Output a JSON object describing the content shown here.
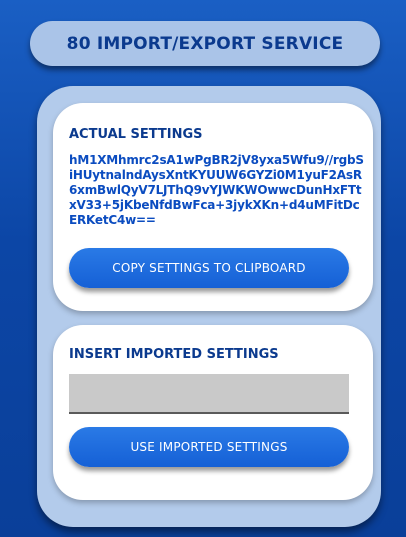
{
  "header": {
    "title": "80 IMPORT/EXPORT SERVICE"
  },
  "actual_settings": {
    "heading": "ACTUAL SETTINGS",
    "value": "hM1XMhmrc2sA1wPgBR2jV8yxa5Wfu9//rgbSiHUytnalndAysXntKYUUW6GYZi0M1yuF2AsR6xmBwlQyV7LJThQ9vYJWKWOwwcDunHxFTtxV33+5jKbeNfdBwFca+3jykXKn+d4uMFitDcERKetC4w==",
    "copy_button_label": "COPY SETTINGS TO CLIPBOARD"
  },
  "insert_settings": {
    "heading": "INSERT IMPORTED SETTINGS",
    "input_value": "",
    "input_placeholder": "",
    "use_button_label": "USE IMPORTED SETTINGS"
  },
  "colors": {
    "background": "#0f4fb0",
    "panel": "#b3cbeb",
    "heading_text": "#0b3a8e",
    "settings_text": "#0b4cc0",
    "button": "#1f6de0",
    "input_fill": "#c9c9c9"
  }
}
